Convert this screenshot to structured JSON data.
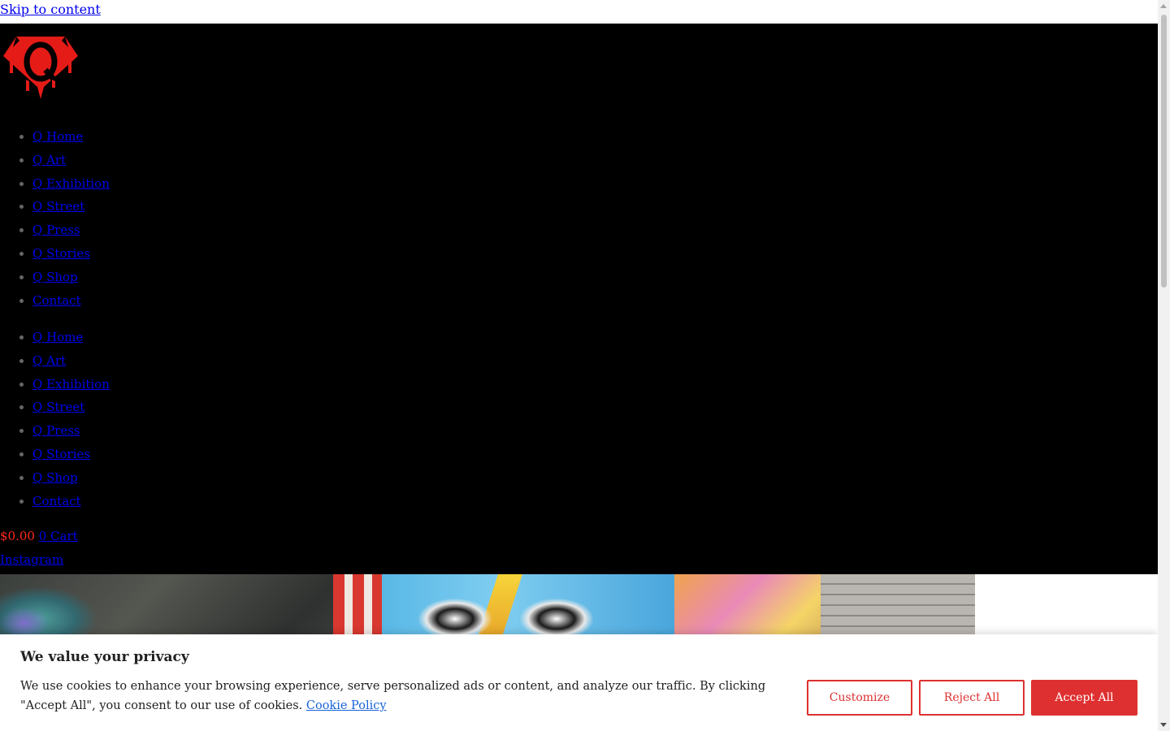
{
  "skip_link": "Skip to content",
  "nav_primary": [
    "Q Home",
    "Q Art",
    "Q Exhibition",
    "Q Street",
    "Q Press",
    "Q Stories",
    "Q Shop",
    "Contact"
  ],
  "nav_secondary": [
    "Q Home",
    "Q Art",
    "Q Exhibition",
    "Q Street",
    "Q Press",
    "Q Stories",
    "Q Shop",
    "Contact"
  ],
  "cart": {
    "amount": "$0.00",
    "label": "0 Cart"
  },
  "social": {
    "instagram": "Instagram"
  },
  "cookie": {
    "title": "We value your privacy",
    "text": "We use cookies to enhance your browsing experience, serve personalized ads or content, and analyze our traffic. By clicking \"Accept All\", you consent to our use of cookies.",
    "policy_link": "Cookie Policy",
    "customize": "Customize",
    "reject": "Reject All",
    "accept": "Accept All"
  },
  "colors": {
    "header_bg": "#000000",
    "logo_red": "#e41b17",
    "accent": "#de3030",
    "link": "#0000ee"
  },
  "icons": {
    "logo": "q-superman-shield-logo"
  }
}
